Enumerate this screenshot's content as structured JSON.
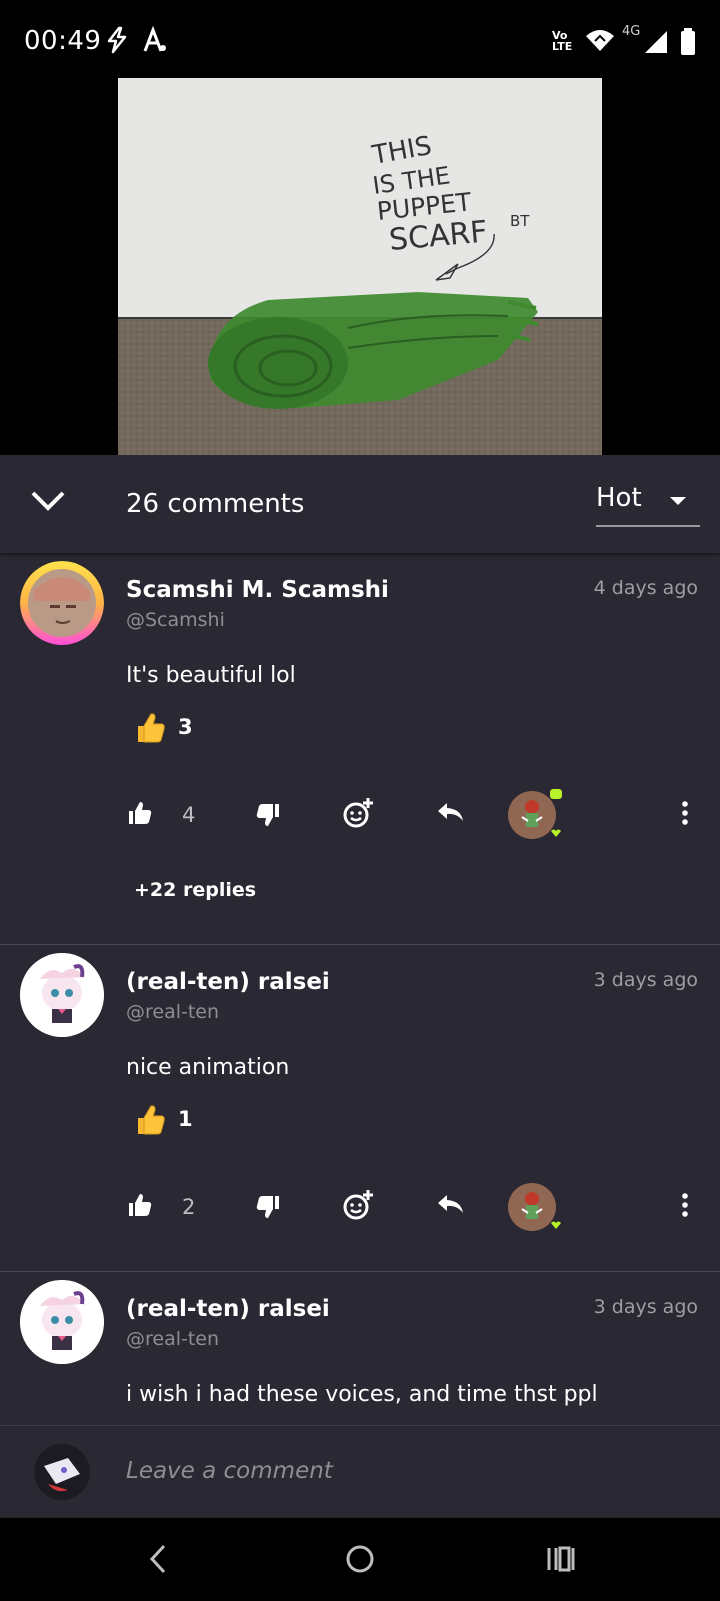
{
  "status_bar": {
    "time": "00:49",
    "network_label": "4G",
    "volte_label": "Vo LTE",
    "icons": [
      "flash-icon",
      "a-icon",
      "volte-icon",
      "wifi-icon",
      "signal-icon",
      "battery-icon"
    ]
  },
  "media": {
    "artwork_text_lines": [
      "THIS",
      "IS THE",
      "PUPPET",
      "SCARF"
    ],
    "artwork_signature": "BT"
  },
  "comments_header": {
    "count_label": "26 comments",
    "sort_label": "Hot"
  },
  "comments": [
    {
      "name": "Scamshi M. Scamshi",
      "handle": "@Scamshi",
      "time": "4 days ago",
      "text": "It's beautiful lol",
      "reaction_count": "3",
      "likes": "4",
      "replies": "+22 replies"
    },
    {
      "name": "(real-ten) ralsei",
      "handle": "@real-ten",
      "time": "3 days ago",
      "text": "nice animation",
      "reaction_count": "1",
      "likes": "2"
    },
    {
      "name": "(real-ten) ralsei",
      "handle": "@real-ten",
      "time": "3 days ago",
      "text": "i wish i had these voices, and time thst ppl"
    }
  ],
  "composer": {
    "placeholder": "Leave a comment"
  },
  "colors": {
    "panel_bg": "#2a2833",
    "muted_text": "#8e8d96",
    "online_dot": "#b8f22a"
  }
}
